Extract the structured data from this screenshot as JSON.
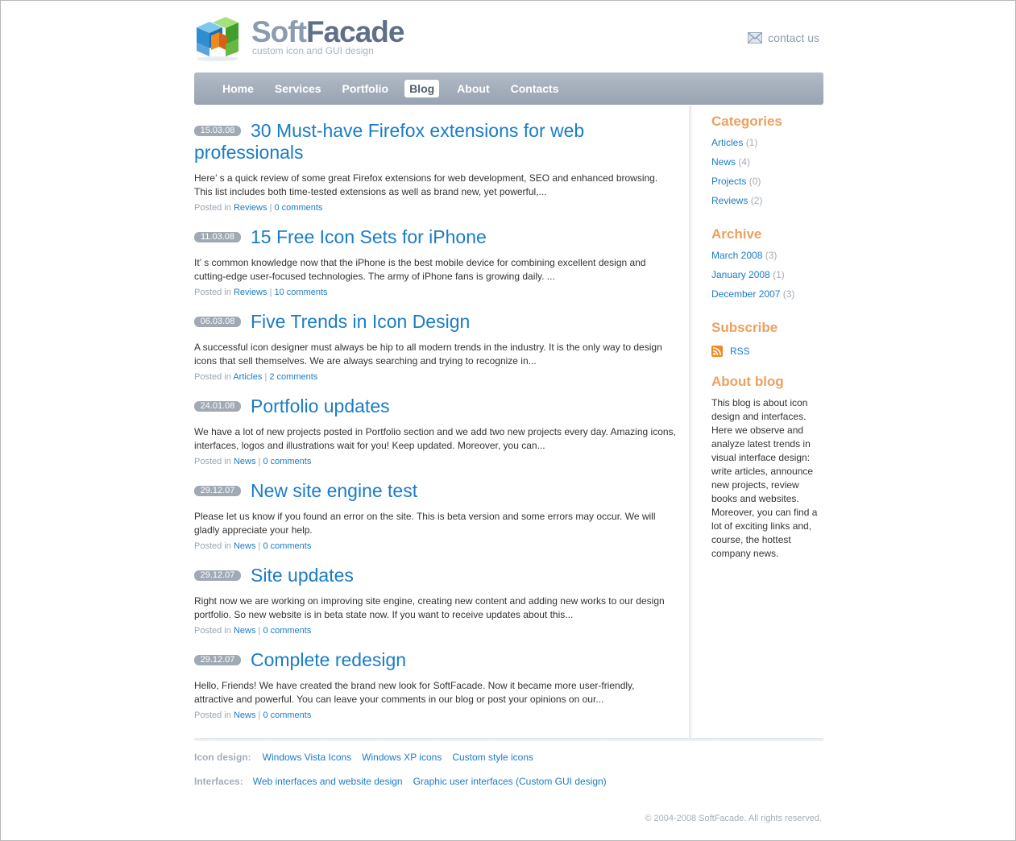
{
  "header": {
    "logo_soft": "Soft",
    "logo_facade": "Facade",
    "logo_tagline": "custom icon and GUI design",
    "contact": "contact us"
  },
  "nav": [
    {
      "label": "Home",
      "active": false
    },
    {
      "label": "Services",
      "active": false
    },
    {
      "label": "Portfolio",
      "active": false
    },
    {
      "label": "Blog",
      "active": true
    },
    {
      "label": "About",
      "active": false
    },
    {
      "label": "Contacts",
      "active": false
    }
  ],
  "posts": [
    {
      "date": "15.03.08",
      "title": "30 Must-have Firefox extensions for web professionals",
      "excerpt": "Here’ s a quick review of some great Firefox extensions for web development, SEO and enhanced browsing. This list includes both time-tested extensions as well as brand new, yet powerful,...",
      "posted_in": "Posted in",
      "category": "Reviews",
      "separator": "|",
      "comments": "0 comments"
    },
    {
      "date": "11.03.08",
      "title": "15 Free Icon Sets for iPhone",
      "excerpt": "It’ s common knowledge now that the iPhone is the best mobile device for combining excellent design and cutting-edge user-focused technologies. The army of iPhone fans is growing daily. ...",
      "posted_in": "Posted in",
      "category": "Reviews",
      "separator": "|",
      "comments": "10 comments"
    },
    {
      "date": "06.03.08",
      "title": "Five Trends in Icon Design",
      "excerpt": "A successful icon designer must always be hip to all modern trends in the industry. It is the only way to design icons that sell themselves. We are always searching and trying to recognize in...",
      "posted_in": "Posted in",
      "category": "Articles",
      "separator": "|",
      "comments": "2 comments"
    },
    {
      "date": "24.01.08",
      "title": "Portfolio updates",
      "excerpt": "We have a lot of new projects posted in Portfolio section and we add two new projects every day. Amazing icons, interfaces, logos and illustrations wait for you! Keep updated. Moreover, you can...",
      "posted_in": "Posted in",
      "category": "News",
      "separator": "|",
      "comments": "0 comments"
    },
    {
      "date": "29.12.07",
      "title": "New site engine test",
      "excerpt": "Please let us know if you found an error on the site. This is beta version and some errors may occur. We will gladly appreciate your help.",
      "posted_in": "Posted in",
      "category": "News",
      "separator": "|",
      "comments": "0 comments"
    },
    {
      "date": "29.12.07",
      "title": "Site updates",
      "excerpt": "Right now we are working on improving site engine, creating new content and adding new works to our design portfolio. So new website is in beta state now. If you want to receive updates about this...",
      "posted_in": "Posted in",
      "category": "News",
      "separator": "|",
      "comments": "0 comments"
    },
    {
      "date": "29.12.07",
      "title": "Complete redesign",
      "excerpt": "Hello, Friends! We have created the brand new look for SoftFacade. Now it became more user-friendly, attractive and powerful. You can leave your comments in our blog or post your opinions on our...",
      "posted_in": "Posted in",
      "category": "News",
      "separator": "|",
      "comments": "0 comments"
    }
  ],
  "sidebar": {
    "categories_title": "Categories",
    "categories": [
      {
        "label": "Articles",
        "count": "(1)"
      },
      {
        "label": "News",
        "count": "(4)"
      },
      {
        "label": "Projects",
        "count": "(0)"
      },
      {
        "label": "Reviews",
        "count": "(2)"
      }
    ],
    "archive_title": "Archive",
    "archive": [
      {
        "label": "March 2008",
        "count": "(3)"
      },
      {
        "label": "January 2008",
        "count": "(1)"
      },
      {
        "label": "December 2007",
        "count": "(3)"
      }
    ],
    "subscribe_title": "Subscribe",
    "rss_label": "RSS",
    "about_title": "About blog",
    "about_text": "This blog is about icon design and interfaces. Here we observe and analyze latest trends in visual interface design: write articles, announce new projects, review books and websites. Moreover, you can find a lot of exciting links and, course, the hottest company news."
  },
  "footer": {
    "icon_design_label": "Icon design:",
    "icon_design_links": [
      "Windows Vista Icons",
      "Windows XP icons",
      "Custom style icons"
    ],
    "interfaces_label": "Interfaces:",
    "interfaces_links": [
      "Web interfaces and website design",
      "Graphic user interfaces (Custom GUI design)"
    ],
    "copyright": "© 2004-2008 SoftFacade. All rights reserved."
  },
  "colors": {
    "link": "#1a7cc6",
    "sidebar_heading": "#eda05f",
    "nav_bar": "#a4aebb",
    "date_badge": "#a0a9b4"
  }
}
